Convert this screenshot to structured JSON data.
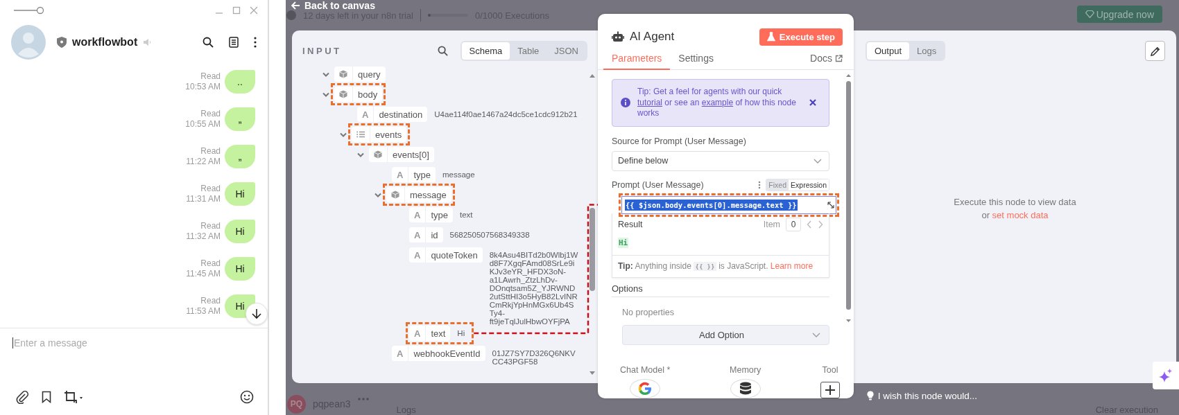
{
  "chat_window": {
    "contact": {
      "name": "workflowbot"
    },
    "messages": [
      {
        "text": "..",
        "status": "Read",
        "time": "10:53 AM"
      },
      {
        "text": "„",
        "status": "Read",
        "time": "10:55 AM"
      },
      {
        "text": "„",
        "status": "Read",
        "time": "11:22 AM"
      },
      {
        "text": "Hi",
        "status": "Read",
        "time": "11:31 AM"
      },
      {
        "text": "Hi",
        "status": "Read",
        "time": "11:32 AM"
      },
      {
        "text": "Hi",
        "status": "Read",
        "time": "11:45 AM"
      },
      {
        "text": "Hi",
        "status": "Read",
        "time": "11:53 AM"
      }
    ],
    "input": {
      "placeholder": "Enter a message"
    }
  },
  "editor": {
    "back_link": "Back to canvas",
    "trial": {
      "text": "12 days left in your n8n trial",
      "level": 0,
      "executions": "0/1000 Executions"
    },
    "upgrade_button": "Upgrade now",
    "input_panel": {
      "title": "INPUT",
      "views": [
        {
          "label": "Schema",
          "selected": true
        },
        {
          "label": "Table",
          "selected": false
        },
        {
          "label": "JSON",
          "selected": false
        }
      ],
      "tree": [
        {
          "key": "query",
          "kind": "object",
          "expanded": true,
          "highlighted": false
        },
        {
          "key": "body",
          "kind": "object",
          "expanded": true,
          "highlighted": true,
          "children": [
            {
              "key": "destination",
              "kind": "string",
              "glyph": "A",
              "value": "U4ae114f0ae1467a24dc5ce1cdc912b21",
              "highlighted": false
            },
            {
              "key": "events",
              "kind": "array",
              "expanded": true,
              "highlighted": true,
              "children": [
                {
                  "key": "events[0]",
                  "kind": "object",
                  "expanded": true,
                  "highlighted": false,
                  "children": [
                    {
                      "key": "type",
                      "kind": "string",
                      "glyph": "A",
                      "value": "message",
                      "highlighted": false
                    },
                    {
                      "key": "message",
                      "kind": "object",
                      "expanded": true,
                      "highlighted": true,
                      "children": [
                        {
                          "key": "type",
                          "kind": "string",
                          "glyph": "A",
                          "value": "text",
                          "highlighted": false
                        },
                        {
                          "key": "id",
                          "kind": "string",
                          "glyph": "A",
                          "value": "568250507568349338",
                          "highlighted": false
                        },
                        {
                          "key": "quoteToken",
                          "kind": "string",
                          "glyph": "A",
                          "value": "8k4Asu4BITd2b0Wlbj1Wd8F7XgqFAmd08SrLe9iKJv3eYR_HFDX3oN-a1LAwrh_ZtzLhDv-DOnqtsam5Z_YJRWND2utSttHI3o5HyB82LvINRCmRkjYpHnMGx6Ub4STy4-ft9jeTqlJulHbwOYFjPA",
                          "highlighted": false
                        },
                        {
                          "key": "text",
                          "kind": "string",
                          "glyph": "A",
                          "value": "Hi",
                          "highlighted": true
                        }
                      ]
                    },
                    {
                      "key": "webhookEventId",
                      "kind": "string",
                      "glyph": "A",
                      "value": "01JZ7SY7D326Q6NKVCC43PGF58",
                      "highlighted": false
                    }
                  ]
                }
              ]
            }
          ]
        }
      ]
    },
    "node_panel": {
      "title": "AI Agent",
      "execute_button": "Execute step",
      "tabs": [
        {
          "label": "Parameters",
          "selected": true
        },
        {
          "label": "Settings",
          "selected": false
        }
      ],
      "docs_link": "Docs",
      "tip": {
        "segments": [
          {
            "text": "Tip: Get a feel for agents with our quick ",
            "link": false
          },
          {
            "text": "tutorial",
            "link": true
          },
          {
            "text": " or see an ",
            "link": false
          },
          {
            "text": "example",
            "link": true
          },
          {
            "text": " of how this node works",
            "link": false
          }
        ]
      },
      "source_field": {
        "label": "Source for Prompt (User Message)",
        "value": "Define below"
      },
      "prompt_field": {
        "label": "Prompt (User Message)",
        "modes": [
          {
            "label": "Fixed",
            "selected": false
          },
          {
            "label": "Expression",
            "selected": true
          }
        ],
        "value": "{{ $json.body.events[0].message.text }}",
        "text_selected": true,
        "highlighted": true
      },
      "result": {
        "label": "Result",
        "item_label": "Item",
        "item_value": "0",
        "value": "Hi"
      },
      "hint": {
        "label": "Tip:",
        "before": "Anything inside",
        "code": "{{ }}",
        "after": "is JavaScript.",
        "link": "Learn more"
      },
      "options": {
        "title": "Options",
        "empty_text": "No properties",
        "add_button": "Add Option"
      },
      "connections": [
        {
          "label": "Chat Model *",
          "kind": "model"
        },
        {
          "label": "Memory",
          "kind": "memory"
        },
        {
          "label": "Tool",
          "kind": "tool"
        }
      ]
    },
    "output_panel": {
      "views": [
        {
          "label": "Output",
          "selected": true
        },
        {
          "label": "Logs",
          "selected": false
        }
      ],
      "empty_text": "Execute this node to view data",
      "empty_prefix": "or",
      "mock_link": "set mock data"
    },
    "footer": {
      "user": {
        "initials": "PQ",
        "name": "pqpean3"
      },
      "logs_label": "Logs",
      "feedback": "I wish this node would...",
      "clear_button": "Clear execution"
    }
  }
}
